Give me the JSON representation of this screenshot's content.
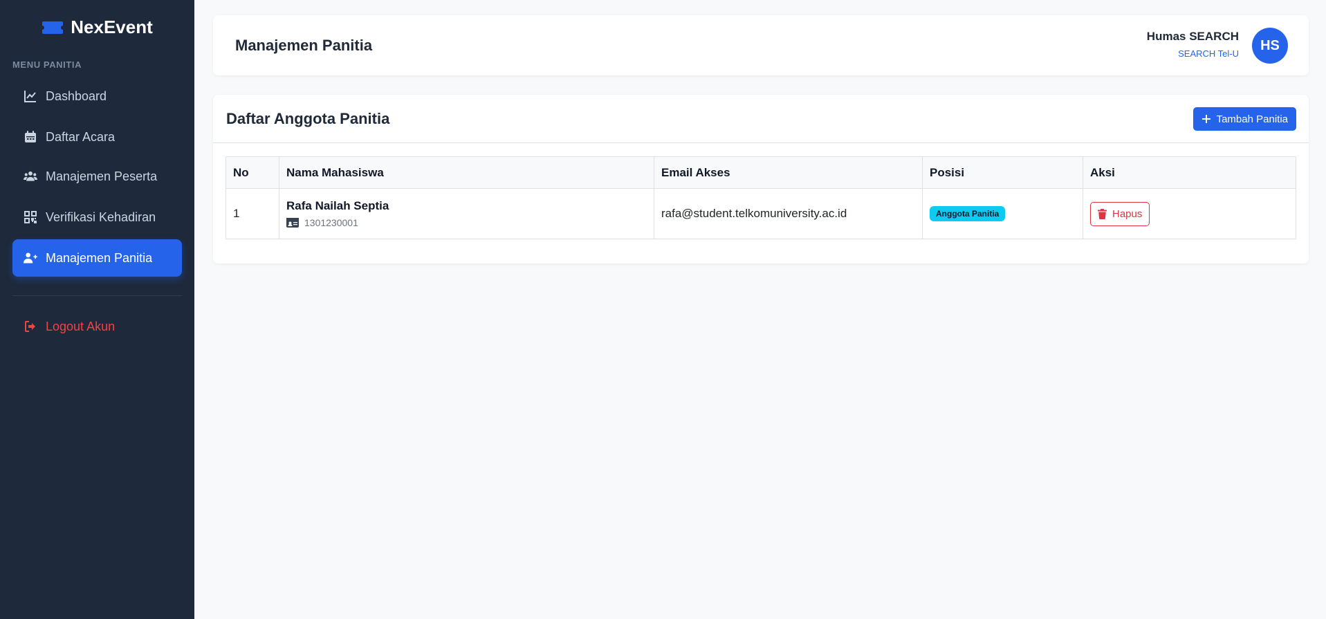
{
  "brand": {
    "name": "NexEvent",
    "icon": "ticket-icon"
  },
  "sidebar": {
    "heading": "MENU PANITIA",
    "items": [
      {
        "label": "Dashboard",
        "icon": "chart-line-icon",
        "active": false
      },
      {
        "label": "Daftar Acara",
        "icon": "calendar-icon",
        "active": false
      },
      {
        "label": "Manajemen Peserta",
        "icon": "users-icon",
        "active": false
      },
      {
        "label": "Verifikasi Kehadiran",
        "icon": "qrcode-icon",
        "active": false
      },
      {
        "label": "Manajemen Panitia",
        "icon": "user-plus-icon",
        "active": true
      }
    ],
    "logout": {
      "label": "Logout Akun",
      "icon": "logout-icon"
    }
  },
  "header": {
    "title": "Manajemen Panitia",
    "user": {
      "name": "Humas SEARCH",
      "org": "SEARCH Tel-U",
      "initials": "HS"
    }
  },
  "main": {
    "card_title": "Daftar Anggota Panitia",
    "add_button": "Tambah Panitia",
    "table": {
      "columns": [
        "No",
        "Nama Mahasiswa",
        "Email Akses",
        "Posisi",
        "Aksi"
      ],
      "rows": [
        {
          "no": "1",
          "name": "Rafa Nailah Septia",
          "nim": "1301230001",
          "email": "rafa@student.telkomuniversity.ac.id",
          "position": "Anggota Panitia",
          "action": "Hapus"
        }
      ]
    }
  },
  "colors": {
    "sidebar_bg": "#1e293b",
    "accent": "#2563eb",
    "danger": "#dc3545",
    "badge": "#0dcaf0"
  }
}
